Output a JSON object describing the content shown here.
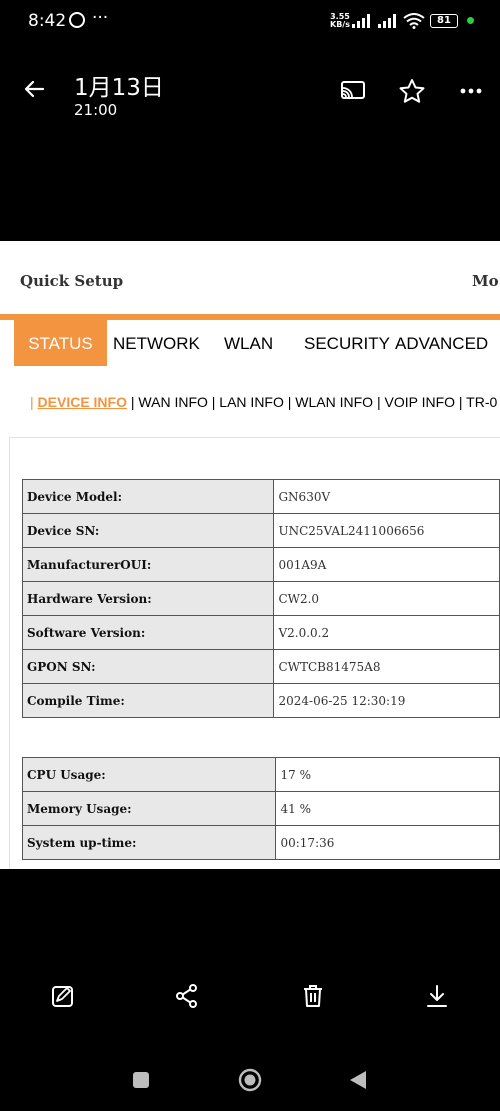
{
  "status_bar": {
    "time": "8:42",
    "dots": "···",
    "speed_value": "3.55",
    "speed_unit": "KB/s",
    "battery": "81"
  },
  "top_bar": {
    "title": "1月13日",
    "subtitle": "21:00"
  },
  "page": {
    "quick_setup": "Quick Setup",
    "mode_truncated": "Mo",
    "nav_tabs": [
      {
        "label": "STATUS",
        "active": true
      },
      {
        "label": "NETWORK"
      },
      {
        "label": "WLAN"
      },
      {
        "label": "SECURITY"
      },
      {
        "label": "ADVANCED"
      }
    ],
    "sub_nav": {
      "leading_sep": "| ",
      "active": "DEVICE INFO",
      "rest": " | WAN INFO | LAN INFO | WLAN INFO | VOIP INFO | TR-0"
    },
    "device_table": [
      {
        "label": "Device Model:",
        "value": "GN630V"
      },
      {
        "label": "Device SN:",
        "value": "UNC25VAL2411006656"
      },
      {
        "label": "ManufacturerOUI:",
        "value": "001A9A"
      },
      {
        "label": "Hardware Version:",
        "value": "CW2.0"
      },
      {
        "label": "Software Version:",
        "value": "V2.0.0.2"
      },
      {
        "label": "GPON SN:",
        "value": "CWTCB81475A8"
      },
      {
        "label": "Compile Time:",
        "value": "2024-06-25 12:30:19"
      }
    ],
    "usage_table": [
      {
        "label": "CPU Usage:",
        "value": "17 %"
      },
      {
        "label": "Memory Usage:",
        "value": "41 %"
      },
      {
        "label": "System up-time:",
        "value": "00:17:36"
      }
    ],
    "accent_color": "#f29440"
  },
  "icons": {
    "top": [
      "back-arrow-icon",
      "cast-icon",
      "star-icon",
      "more-icon"
    ],
    "bottom": [
      "edit-icon",
      "share-icon",
      "delete-icon",
      "download-icon"
    ],
    "nav": [
      "recents-icon",
      "home-icon",
      "back-icon"
    ]
  }
}
